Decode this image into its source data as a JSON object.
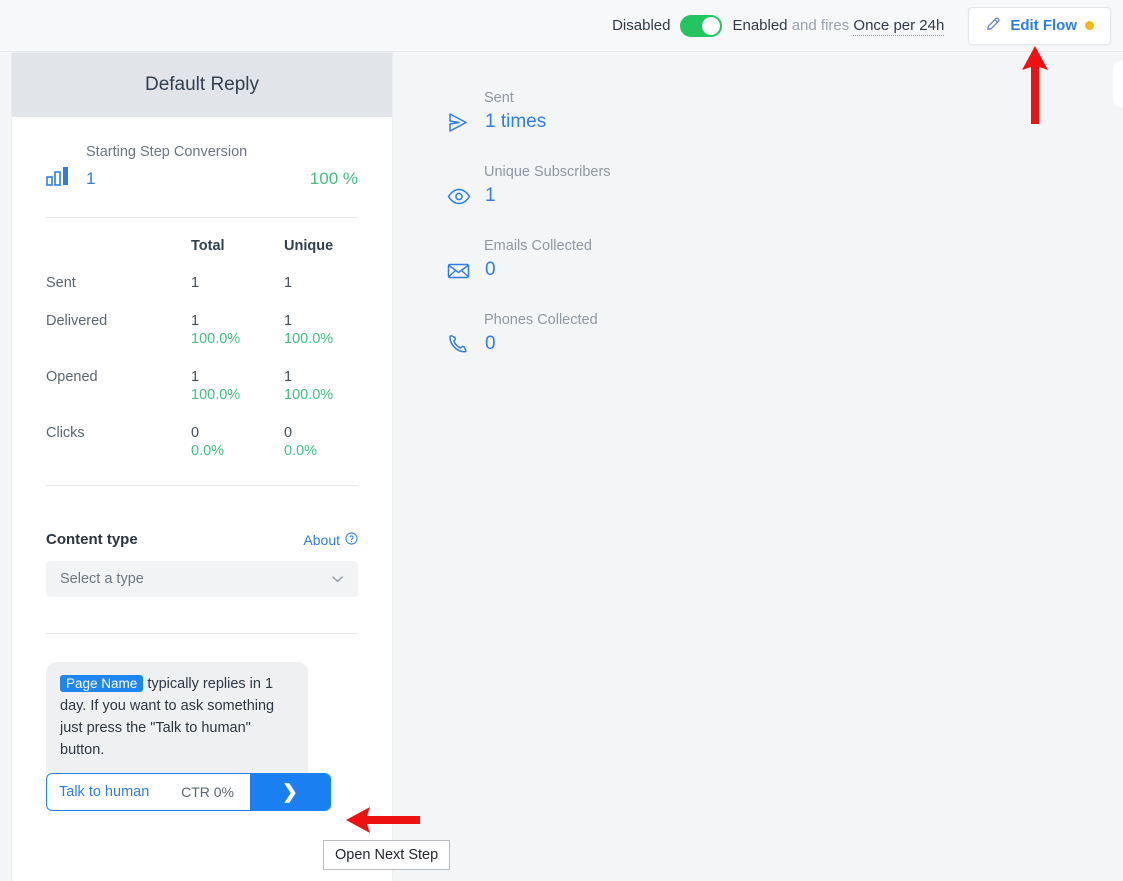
{
  "topbar": {
    "disabled_label": "Disabled",
    "toggle_state": "on",
    "enabled_word": "Enabled",
    "and_fires": "and fires",
    "frequency": "Once per 24h",
    "edit_flow_label": "Edit Flow",
    "status_dot_color": "#f5b81b",
    "toggle_on_color": "#22c55e"
  },
  "left_panel": {
    "header_title": "Default Reply",
    "conversion": {
      "label": "Starting Step Conversion",
      "value": "1",
      "percent": "100 %",
      "icon": "bar-chart-icon"
    },
    "stats_table": {
      "columns": [
        "",
        "Total",
        "Unique"
      ],
      "rows": [
        {
          "label": "Sent",
          "total": "1",
          "total_pct": "",
          "unique": "1",
          "unique_pct": ""
        },
        {
          "label": "Delivered",
          "total": "1",
          "total_pct": "100.0%",
          "unique": "1",
          "unique_pct": "100.0%"
        },
        {
          "label": "Opened",
          "total": "1",
          "total_pct": "100.0%",
          "unique": "1",
          "unique_pct": "100.0%"
        },
        {
          "label": "Clicks",
          "total": "0",
          "total_pct": "0.0%",
          "unique": "0",
          "unique_pct": "0.0%"
        }
      ]
    },
    "content_type": {
      "title": "Content type",
      "about_label": "About",
      "select_placeholder": "Select a type"
    },
    "message": {
      "page_tag": "Page Name",
      "text_part1": " typically replies in 1 day. If you want to ask something just press the \"Talk to human\" button.",
      "button_label": "Talk to human",
      "ctr_label": "CTR 0%",
      "next_icon": "chevron-right-icon"
    },
    "tooltip": "Open Next Step"
  },
  "right_stats": [
    {
      "label": "Sent",
      "value": "1 times",
      "icon": "send-icon"
    },
    {
      "label": "Unique Subscribers",
      "value": "1",
      "icon": "eye-icon"
    },
    {
      "label": "Emails Collected",
      "value": "0",
      "icon": "envelope-icon"
    },
    {
      "label": "Phones Collected",
      "value": "0",
      "icon": "phone-icon"
    }
  ],
  "annotations": {
    "arrow_color": "#ee1111",
    "arrow_up_target": "Edit Flow",
    "arrow_left_target": "Open Next Step"
  }
}
